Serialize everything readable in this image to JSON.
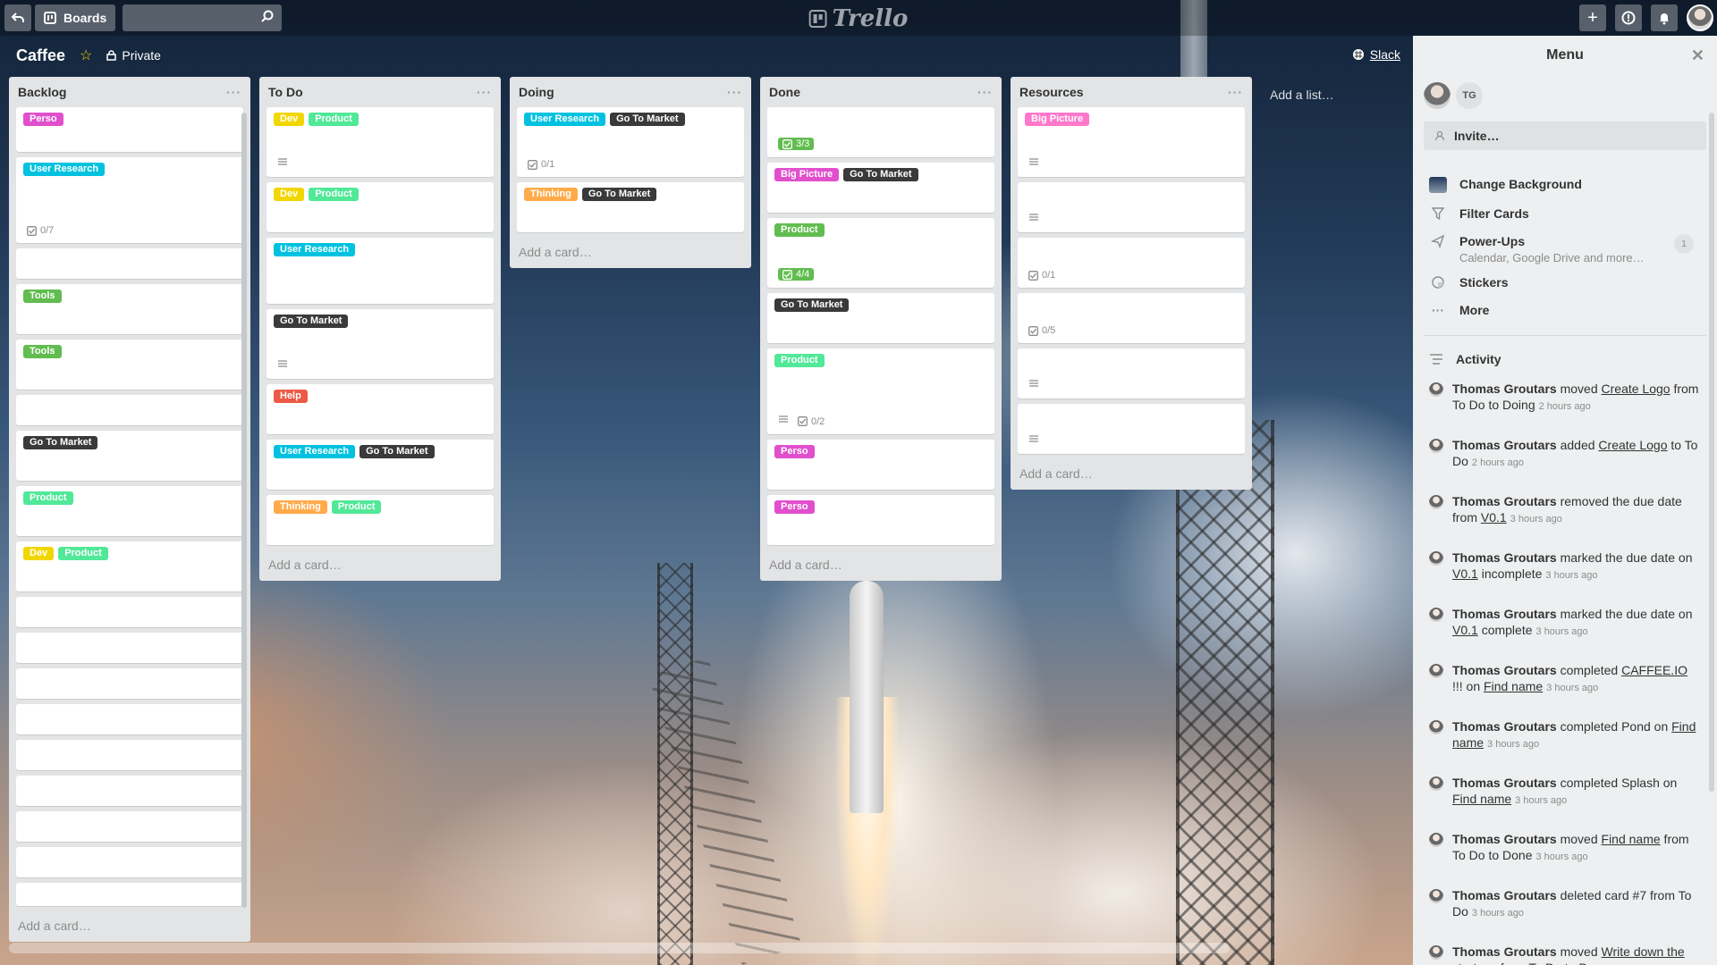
{
  "header": {
    "boards_label": "Boards",
    "logo_text": "Trello",
    "search_placeholder": ""
  },
  "board": {
    "title": "Caffee",
    "privacy": "Private",
    "slack": "Slack",
    "add_list": "Add a list…"
  },
  "lists": [
    {
      "title": "Backlog",
      "add_card": "Add a card…",
      "cards": [
        {
          "labels": [
            {
              "text": "Perso",
              "color": "#e14fcd"
            }
          ],
          "badges": [],
          "h": 50
        },
        {
          "labels": [
            {
              "text": "User Research",
              "color": "#00c2e0"
            }
          ],
          "badges": [
            {
              "type": "checklist",
              "text": "0/7"
            }
          ],
          "h": 96
        },
        {
          "labels": [],
          "badges": [],
          "h": 34
        },
        {
          "labels": [
            {
              "text": "Tools",
              "color": "#61bd4f"
            }
          ],
          "badges": [],
          "h": 56
        },
        {
          "labels": [
            {
              "text": "Tools",
              "color": "#61bd4f"
            }
          ],
          "badges": [],
          "h": 56
        },
        {
          "labels": [],
          "badges": [],
          "h": 34
        },
        {
          "labels": [
            {
              "text": "Go To Market",
              "color": "#3a3a3a"
            }
          ],
          "badges": [],
          "h": 56
        },
        {
          "labels": [
            {
              "text": "Product",
              "color": "#51e898"
            }
          ],
          "badges": [],
          "h": 56
        },
        {
          "labels": [
            {
              "text": "Dev",
              "color": "#f2d600"
            },
            {
              "text": "Product",
              "color": "#51e898"
            }
          ],
          "badges": [],
          "h": 56
        },
        {
          "labels": [],
          "badges": [],
          "h": 34
        },
        {
          "labels": [],
          "badges": [],
          "h": 34
        },
        {
          "labels": [],
          "badges": [],
          "h": 34
        },
        {
          "labels": [],
          "badges": [],
          "h": 34
        },
        {
          "labels": [],
          "badges": [],
          "h": 34
        },
        {
          "labels": [],
          "badges": [],
          "h": 34
        },
        {
          "labels": [],
          "badges": [],
          "h": 34
        },
        {
          "labels": [],
          "badges": [],
          "h": 34
        },
        {
          "labels": [],
          "badges": [],
          "h": 26
        }
      ]
    },
    {
      "title": "To Do",
      "add_card": "Add a card…",
      "cards": [
        {
          "labels": [
            {
              "text": "Dev",
              "color": "#f2d600"
            },
            {
              "text": "Product",
              "color": "#51e898"
            }
          ],
          "badges": [
            {
              "type": "description",
              "text": ""
            }
          ],
          "h": 78
        },
        {
          "labels": [
            {
              "text": "Dev",
              "color": "#f2d600"
            },
            {
              "text": "Product",
              "color": "#51e898"
            }
          ],
          "badges": [],
          "h": 56
        },
        {
          "labels": [
            {
              "text": "User Research",
              "color": "#00c2e0"
            }
          ],
          "badges": [],
          "h": 74
        },
        {
          "labels": [
            {
              "text": "Go To Market",
              "color": "#3a3a3a"
            }
          ],
          "badges": [
            {
              "type": "description",
              "text": ""
            }
          ],
          "h": 78
        },
        {
          "labels": [
            {
              "text": "Help",
              "color": "#eb5a46"
            }
          ],
          "badges": [],
          "h": 56
        },
        {
          "labels": [
            {
              "text": "User Research",
              "color": "#00c2e0"
            },
            {
              "text": "Go To Market",
              "color": "#3a3a3a"
            }
          ],
          "badges": [],
          "h": 56
        },
        {
          "labels": [
            {
              "text": "Thinking",
              "color": "#ffab4a"
            },
            {
              "text": "Product",
              "color": "#51e898"
            }
          ],
          "badges": [],
          "h": 56
        }
      ]
    },
    {
      "title": "Doing",
      "add_card": "Add a card…",
      "cards": [
        {
          "labels": [
            {
              "text": "User Research",
              "color": "#00c2e0"
            },
            {
              "text": "Go To Market",
              "color": "#3a3a3a"
            }
          ],
          "badges": [
            {
              "type": "checklist",
              "text": "0/1"
            }
          ],
          "h": 78
        },
        {
          "labels": [
            {
              "text": "Thinking",
              "color": "#ffab4a"
            },
            {
              "text": "Go To Market",
              "color": "#3a3a3a"
            }
          ],
          "badges": [],
          "h": 56
        }
      ]
    },
    {
      "title": "Done",
      "add_card": "Add a card…",
      "cards": [
        {
          "labels": [],
          "badges": [
            {
              "type": "checklist-done",
              "text": "3/3"
            }
          ],
          "h": 56
        },
        {
          "labels": [
            {
              "text": "Big Picture",
              "color": "#e14fcd"
            },
            {
              "text": "Go To Market",
              "color": "#3a3a3a"
            }
          ],
          "badges": [],
          "h": 56
        },
        {
          "labels": [
            {
              "text": "Product",
              "color": "#61bd4f"
            }
          ],
          "badges": [
            {
              "type": "checklist-done",
              "text": "4/4"
            }
          ],
          "h": 78
        },
        {
          "labels": [
            {
              "text": "Go To Market",
              "color": "#3a3a3a"
            }
          ],
          "badges": [],
          "h": 56
        },
        {
          "labels": [
            {
              "text": "Product",
              "color": "#51e898"
            }
          ],
          "badges": [
            {
              "type": "description",
              "text": ""
            },
            {
              "type": "checklist",
              "text": "0/2"
            }
          ],
          "h": 96
        },
        {
          "labels": [
            {
              "text": "Perso",
              "color": "#e14fcd"
            }
          ],
          "badges": [],
          "h": 56
        },
        {
          "labels": [
            {
              "text": "Perso",
              "color": "#e14fcd"
            }
          ],
          "badges": [],
          "h": 56
        }
      ]
    },
    {
      "title": "Resources",
      "add_card": "Add a card…",
      "cards": [
        {
          "labels": [
            {
              "text": "Big Picture",
              "color": "#ff78cb"
            }
          ],
          "badges": [
            {
              "type": "description",
              "text": ""
            }
          ],
          "h": 78
        },
        {
          "labels": [],
          "badges": [
            {
              "type": "description",
              "text": ""
            }
          ],
          "h": 56
        },
        {
          "labels": [],
          "badges": [
            {
              "type": "checklist",
              "text": "0/1"
            }
          ],
          "h": 56
        },
        {
          "labels": [],
          "badges": [
            {
              "type": "checklist",
              "text": "0/5"
            }
          ],
          "h": 56
        },
        {
          "labels": [],
          "badges": [
            {
              "type": "description",
              "text": ""
            }
          ],
          "h": 56
        },
        {
          "labels": [],
          "badges": [
            {
              "type": "description",
              "text": ""
            }
          ],
          "h": 56
        }
      ]
    }
  ],
  "menu": {
    "title": "Menu",
    "member_initials": "TG",
    "invite": "Invite…",
    "items": [
      {
        "label": "Change Background",
        "sub": "",
        "icon": "background-swatch-icon"
      },
      {
        "label": "Filter Cards",
        "sub": "",
        "icon": "filter-icon"
      },
      {
        "label": "Power-Ups",
        "sub": "Calendar, Google Drive and more…",
        "icon": "power-ups-icon",
        "count": "1"
      },
      {
        "label": "Stickers",
        "sub": "",
        "icon": "sticker-icon"
      },
      {
        "label": "More",
        "sub": "",
        "icon": "more-icon"
      }
    ],
    "activity_title": "Activity",
    "activity": [
      {
        "user": "Thomas Groutars",
        "parts": [
          " moved ",
          {
            "link": "Create Logo"
          },
          " from To Do to Doing"
        ],
        "time": "2 hours ago"
      },
      {
        "user": "Thomas Groutars",
        "parts": [
          " added ",
          {
            "link": "Create Logo"
          },
          " to To Do"
        ],
        "time": "2 hours ago"
      },
      {
        "user": "Thomas Groutars",
        "parts": [
          " removed the due date from ",
          {
            "link": "V0.1"
          }
        ],
        "time": "3 hours ago"
      },
      {
        "user": "Thomas Groutars",
        "parts": [
          " marked the due date on ",
          {
            "link": "V0.1"
          },
          " incomplete"
        ],
        "time": "3 hours ago"
      },
      {
        "user": "Thomas Groutars",
        "parts": [
          " marked the due date on ",
          {
            "link": "V0.1"
          },
          " complete"
        ],
        "time": "3 hours ago"
      },
      {
        "user": "Thomas Groutars",
        "parts": [
          " completed ",
          {
            "link": "CAFFEE.IO"
          },
          " !!! on ",
          {
            "link": "Find name"
          }
        ],
        "time": "3 hours ago"
      },
      {
        "user": "Thomas Groutars",
        "parts": [
          " completed Pond on ",
          {
            "link": "Find name"
          }
        ],
        "time": "3 hours ago"
      },
      {
        "user": "Thomas Groutars",
        "parts": [
          " completed Splash on ",
          {
            "link": "Find name"
          }
        ],
        "time": "3 hours ago"
      },
      {
        "user": "Thomas Groutars",
        "parts": [
          " moved ",
          {
            "link": "Find name"
          },
          " from To Do to Done"
        ],
        "time": "3 hours ago"
      },
      {
        "user": "Thomas Groutars",
        "parts": [
          " deleted card #7 from To Do"
        ],
        "time": "3 hours ago"
      },
      {
        "user": "Thomas Groutars",
        "parts": [
          " moved ",
          {
            "link": "Write down the strategy"
          },
          " from To Do to Done"
        ],
        "time": ""
      }
    ]
  }
}
